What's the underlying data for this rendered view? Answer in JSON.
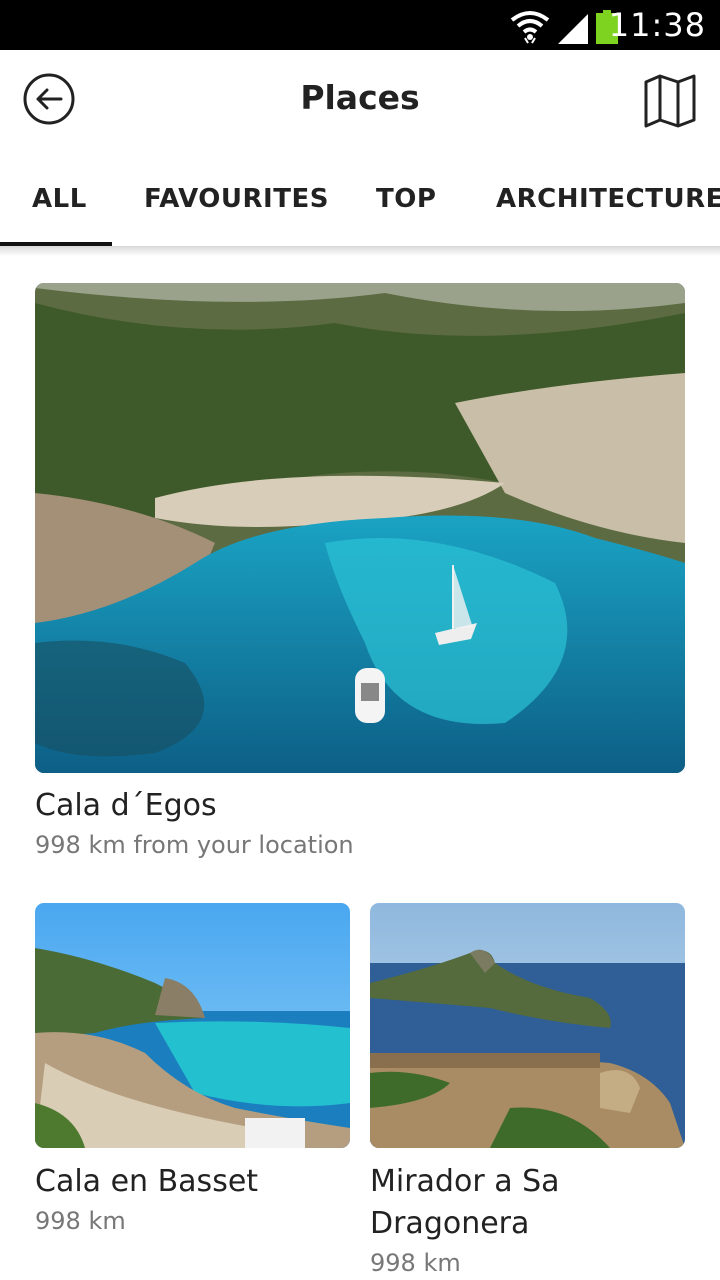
{
  "status_bar": {
    "time": "11:38",
    "icons": [
      "wifi-icon",
      "signal-icon",
      "battery-icon"
    ]
  },
  "app_bar": {
    "title": "Places",
    "back_icon": "back-arrow-icon",
    "map_icon": "map-icon"
  },
  "tabs": [
    {
      "label": "ALL",
      "selected": true
    },
    {
      "label": "FAVOURITES",
      "selected": false
    },
    {
      "label": "TOP",
      "selected": false
    },
    {
      "label": "ARCHITECTURE",
      "selected": false
    }
  ],
  "places": [
    {
      "name": "Cala d´Egos",
      "distance": "998 km from your location"
    },
    {
      "name": "Cala en Basset",
      "distance": "998 km"
    },
    {
      "name": "Mirador a Sa\nDragonera",
      "distance": "998 km"
    }
  ],
  "colors": {
    "status_bar": "#000000",
    "battery": "#7ed321",
    "tab_indicator": "#111111",
    "subtext": "#777777"
  }
}
